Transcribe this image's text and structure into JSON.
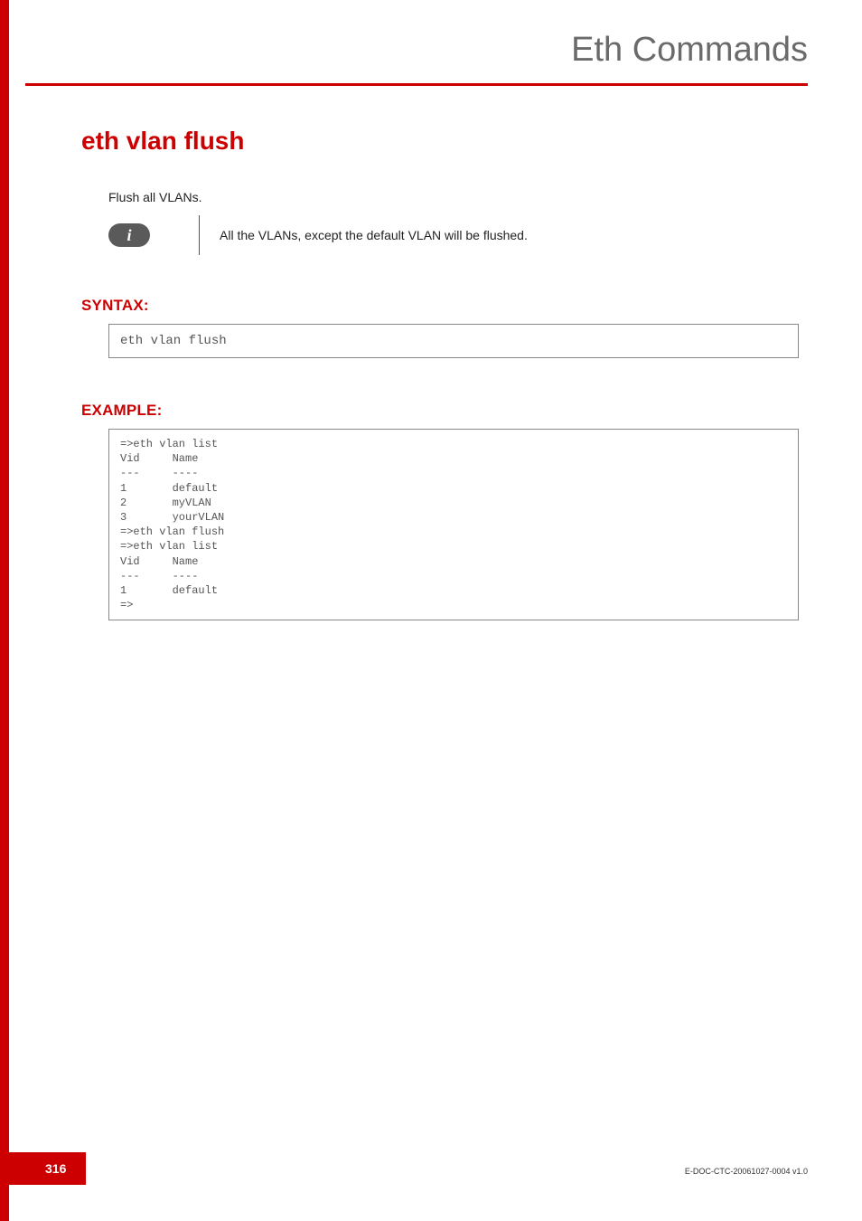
{
  "chapter_title": "Eth Commands",
  "command_title": "eth vlan flush",
  "intro_line": "Flush all VLANs.",
  "note": {
    "badge": "i",
    "text": "All the VLANs, except the default VLAN will be flushed."
  },
  "sections": {
    "syntax": {
      "heading": "SYNTAX:",
      "code": "eth vlan flush"
    },
    "example": {
      "heading": "EXAMPLE:",
      "code": "=>eth vlan list\nVid     Name\n---     ----\n1       default\n2       myVLAN\n3       yourVLAN\n=>eth vlan flush\n=>eth vlan list\nVid     Name\n---     ----\n1       default\n=>"
    }
  },
  "footer": {
    "page_number": "316",
    "doc_code": "E-DOC-CTC-20061027-0004 v1.0"
  }
}
